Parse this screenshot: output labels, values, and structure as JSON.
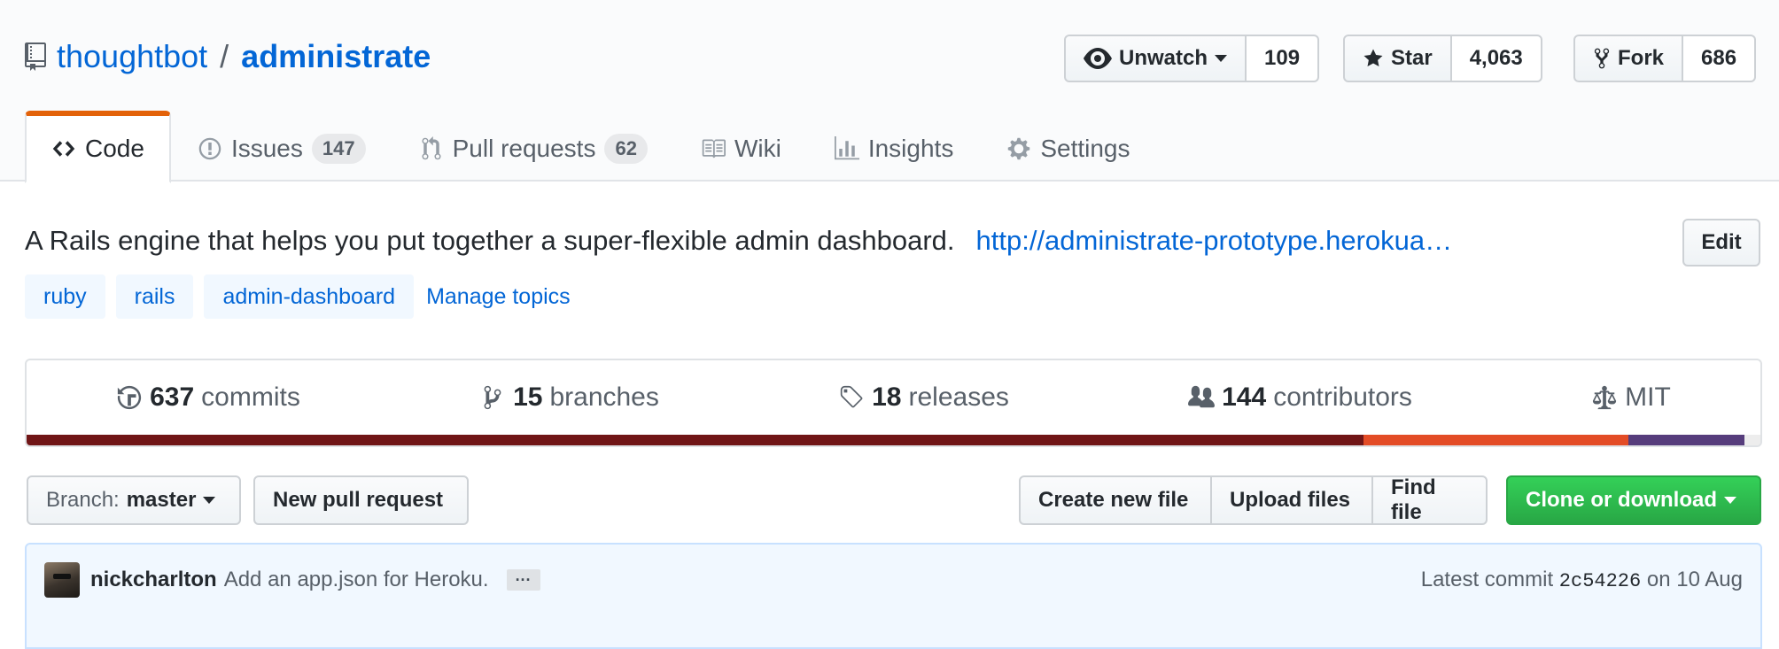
{
  "repo": {
    "owner": "thoughtbot",
    "separator": "/",
    "name": "administrate"
  },
  "actions": {
    "watch": {
      "label": "Unwatch",
      "count": "109"
    },
    "star": {
      "label": "Star",
      "count": "4,063"
    },
    "fork": {
      "label": "Fork",
      "count": "686"
    }
  },
  "tabs": [
    {
      "label": "Code",
      "icon": "code-icon"
    },
    {
      "label": "Issues",
      "count": "147",
      "icon": "issue-icon"
    },
    {
      "label": "Pull requests",
      "count": "62",
      "icon": "pull-request-icon"
    },
    {
      "label": "Wiki",
      "icon": "book-icon"
    },
    {
      "label": "Insights",
      "icon": "graph-icon"
    },
    {
      "label": "Settings",
      "icon": "gear-icon"
    }
  ],
  "description": {
    "text": "A Rails engine that helps you put together a super-flexible admin dashboard.",
    "homepage": "http://administrate-prototype.herokua…",
    "edit_label": "Edit"
  },
  "topics": {
    "tags": [
      "ruby",
      "rails",
      "admin-dashboard"
    ],
    "manage_label": "Manage topics"
  },
  "summary": {
    "commits": {
      "num": "637",
      "label": "commits"
    },
    "branches": {
      "num": "15",
      "label": "branches"
    },
    "releases": {
      "num": "18",
      "label": "releases"
    },
    "contributors": {
      "num": "144",
      "label": "contributors"
    },
    "license": {
      "label": "MIT"
    }
  },
  "languages": [
    {
      "fraction": 0.771,
      "color": "#701516"
    },
    {
      "fraction": 0.153,
      "color": "#e34c26"
    },
    {
      "fraction": 0.067,
      "color": "#563d7c"
    },
    {
      "fraction": 0.009,
      "color": "#ededed"
    }
  ],
  "file_nav": {
    "branch_prefix": "Branch:",
    "branch_name": "master",
    "new_pr": "New pull request",
    "create_file": "Create new file",
    "upload_files": "Upload files",
    "find_file": "Find file",
    "clone": "Clone or download"
  },
  "commit": {
    "author": "nickcharlton",
    "message": "Add an app.json for Heroku.",
    "ellipsis": "···",
    "prefix": "Latest commit",
    "sha": "2c54226",
    "date": "on 10 Aug"
  }
}
